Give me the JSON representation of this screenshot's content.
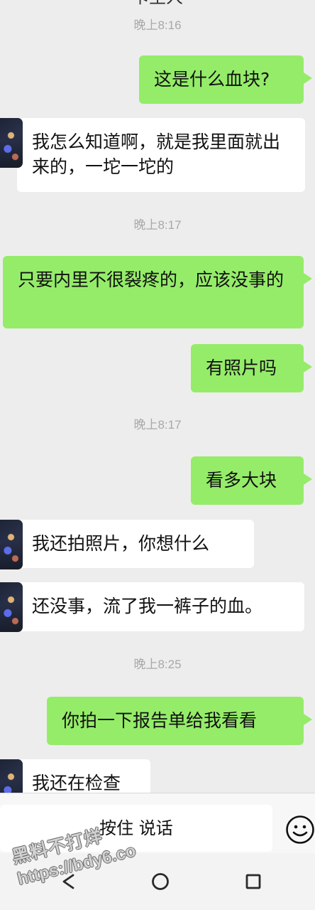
{
  "header": {
    "title": "卡生人"
  },
  "timestamps": [
    "晚上8:16",
    "晚上8:17",
    "晚上8:17",
    "晚上8:25"
  ],
  "messages": [
    {
      "text": "这是什么血块?"
    },
    {
      "text": "我怎么知道啊，就是我里面就出来的，一坨一坨的"
    },
    {
      "text": "只要内里不很裂疼的，应该没事的"
    },
    {
      "text": "有照片吗"
    },
    {
      "text": "看多大块"
    },
    {
      "text": "我还拍照片，你想什么"
    },
    {
      "text": "还没事，流了我一裤子的血。"
    },
    {
      "text": "你拍一下报告单给我看看"
    },
    {
      "text": "我还在检查"
    }
  ],
  "input": {
    "voice_label": "按住 说话"
  },
  "watermark": {
    "line1": "黑料不打烊",
    "line2": "https://bdy6.co"
  },
  "icons": {
    "emoji": "emoji-icon",
    "back": "back-icon",
    "home": "home-icon",
    "recent": "recent-apps-icon"
  },
  "colors": {
    "chat_background": "#ededed",
    "sent_bubble": "#95ec69",
    "received_bubble": "#ffffff",
    "timestamp_text": "#a8a8a8"
  }
}
